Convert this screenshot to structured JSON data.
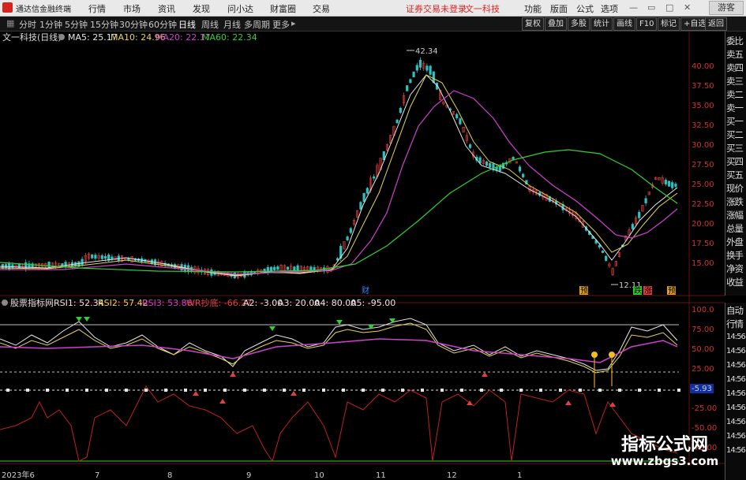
{
  "app": {
    "title": "通达信金融终端",
    "menu": [
      "行情",
      "市场",
      "资讯",
      "发现",
      "问小达",
      "财富圈",
      "交易"
    ],
    "notice": "证券交易未登录",
    "stock_link": "文一科技",
    "right_menu": [
      "功能",
      "版面",
      "公式",
      "选项"
    ],
    "guest": "游客"
  },
  "periods": [
    "分时",
    "1分钟",
    "5分钟",
    "15分钟",
    "30分钟",
    "60分钟",
    "日线",
    "周线",
    "月线",
    "多周期",
    "更多"
  ],
  "active_period": "日线",
  "right_buttons": [
    "复权",
    "叠加",
    "多股",
    "统计",
    "画线",
    "F10",
    "标记",
    "+自选",
    "返回"
  ],
  "main_chart": {
    "stock_name": "文一科技(日线)",
    "ma": [
      {
        "label": "MA5: 25.17",
        "color": "#e6e6e6"
      },
      {
        "label": "MA10: 24.96",
        "color": "#e6d650"
      },
      {
        "label": "MA20: 22.17",
        "color": "#d040d0"
      },
      {
        "label": "MA60: 22.34",
        "color": "#30d030"
      }
    ],
    "price_axis": [
      "40.00",
      "37.50",
      "35.00",
      "32.50",
      "30.00",
      "27.50",
      "25.00",
      "22.50",
      "20.00",
      "17.50",
      "15.00"
    ],
    "high_label": "42.34",
    "low_label": "12.11",
    "event_tags": [
      {
        "text": "财",
        "color": "#4080ff"
      },
      {
        "text": "预",
        "color": "#e0a020"
      },
      {
        "text": "跌",
        "color": "#30d030"
      },
      {
        "text": "涨",
        "color": "#e04040"
      },
      {
        "text": "预",
        "color": "#e0a020"
      }
    ]
  },
  "indicator": {
    "name": "股票指标网",
    "values": [
      {
        "label": "RSI1: 52.34",
        "color": "#e6e6e6"
      },
      {
        "label": "RSI2: 57.42",
        "color": "#e6d650"
      },
      {
        "label": "RSI3: 53.86",
        "color": "#d040d0"
      },
      {
        "label": "WR抄底: -66.27",
        "color": "#e04040"
      },
      {
        "label": "A2: -3.00",
        "color": "#e6e6e6"
      },
      {
        "label": "A3: 20.00",
        "color": "#e6e6e6"
      },
      {
        "label": "A4: 80.00",
        "color": "#e6e6e6"
      },
      {
        "label": "A5: -95.00",
        "color": "#e6e6e6"
      }
    ],
    "axis": [
      "100.0",
      "75.00",
      "50.00",
      "25.00",
      "-5.93",
      "-25.00",
      "-50.00",
      "-75.00"
    ],
    "current_badge": "-5.93"
  },
  "right_sidebar": [
    "委比",
    "卖五",
    "卖四",
    "卖三",
    "卖二",
    "卖一",
    "买一",
    "买二",
    "买三",
    "买四",
    "买五",
    "现价",
    "涨跌",
    "涨幅",
    "总量",
    "外盘",
    "换手",
    "净资",
    "收益"
  ],
  "right_sidebar2": [
    "自动",
    "行情",
    "14:56",
    "14:56",
    "14:56",
    "14:56",
    "14:56",
    "14:56",
    "14:56",
    "14:56",
    "14:56"
  ],
  "date_axis": [
    "2023年6",
    "7",
    "8",
    "9",
    "10",
    "11",
    "12",
    "1"
  ],
  "watermark": {
    "line1": "指标公式网",
    "line2": "www.zbgs3.com"
  },
  "colors": {
    "up": "#e04040",
    "down": "#30c0c0",
    "bg": "#000000",
    "accent": "#d22222"
  }
}
